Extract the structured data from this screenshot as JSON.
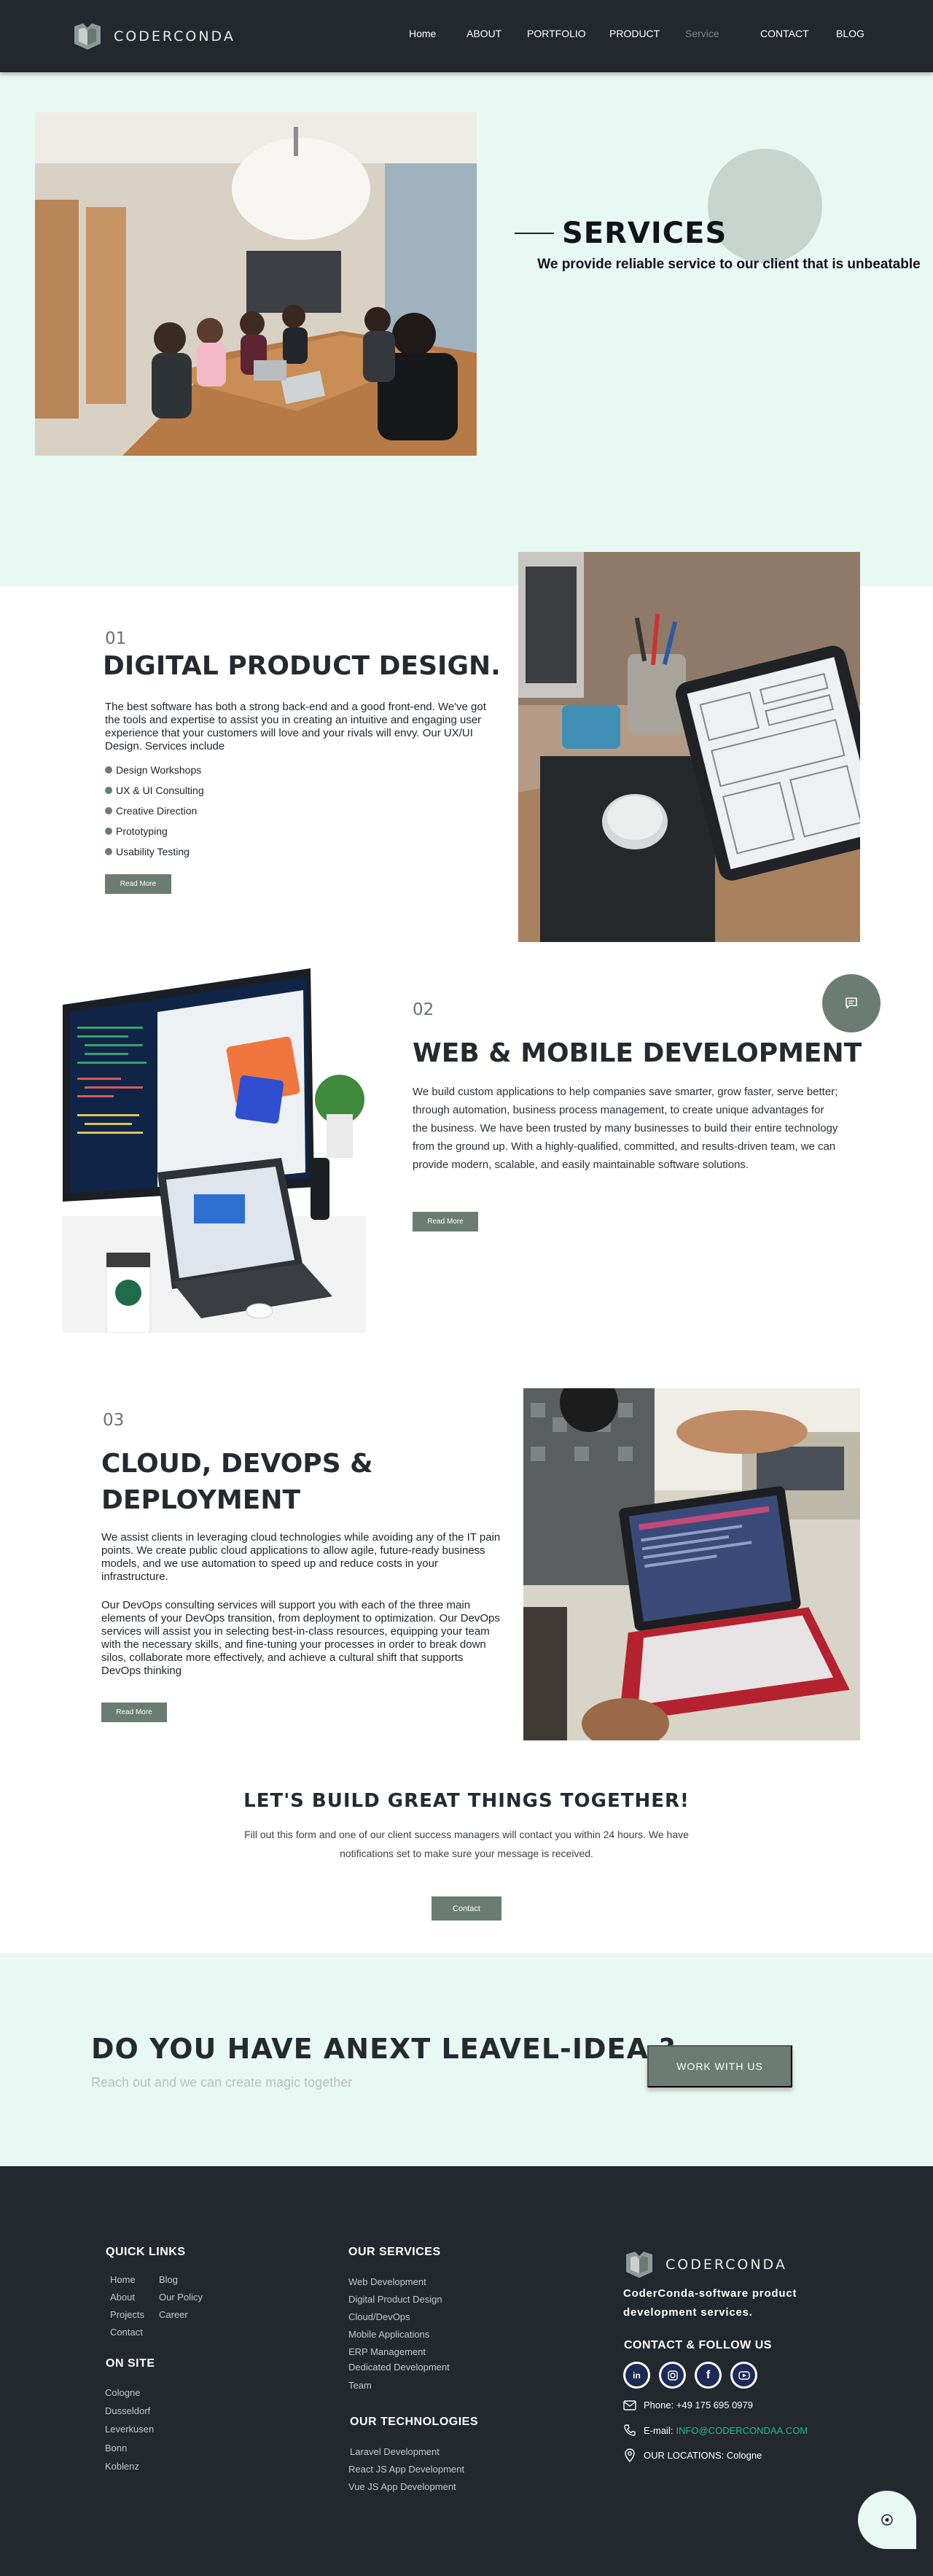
{
  "brand": {
    "name": "CODERCONDA"
  },
  "nav": [
    {
      "label": "Home"
    },
    {
      "label": "ABOUT"
    },
    {
      "label": "PORTFOLIO"
    },
    {
      "label": "PRODUCT"
    },
    {
      "label": "Service"
    },
    {
      "label": "CONTACT"
    },
    {
      "label": "BLOG"
    }
  ],
  "hero": {
    "title": "SERVICES",
    "subtitle": "We provide reliable service to our client that is unbeatable"
  },
  "services": [
    {
      "number": "01",
      "title": "DIGITAL PRODUCT DESIGN.",
      "text": "The best software has both a strong back-end and a good front-end. We've got the tools and expertise to assist you in creating an intuitive and engaging user experience that your customers will love and your rivals will envy. Our UX/UI Design. Services include",
      "bullets": [
        "Design Workshops",
        "UX & UI Consulting",
        "Creative Direction",
        "Prototyping",
        "Usability Testing"
      ],
      "button": "Read More"
    },
    {
      "number": "02",
      "title": "WEB & MOBILE DEVELOPMENT",
      "text": "We build custom applications to help companies save smarter, grow faster, serve better; through automation, business process management, to create unique advantages for the business. We have been trusted by many businesses to build their entire technology from the ground up. With a highly-qualified, committed, and results-driven team, we can provide modern, scalable, and easily maintainable software solutions.",
      "button": "Read More"
    },
    {
      "number": "03",
      "title_line1": "CLOUD, DEVOPS &",
      "title_line2": "DEPLOYMENT",
      "text": "We assist clients in leveraging cloud technologies while avoiding any of the IT pain points. We create public cloud applications to allow agile, future-ready business models, and we use automation to speed up and reduce costs in your infrastructure.",
      "text2": "Our DevOps consulting services will support you with each of the three main elements of your DevOps transition, from deployment to optimization. Our DevOps services will assist you in selecting best-in-class resources, equipping your team with the necessary skills, and fine-tuning your processes in order to break down silos, collaborate more effectively, and achieve a cultural shift that supports DevOps thinking",
      "button": "Read More"
    }
  ],
  "cta": {
    "title": "LET'S BUILD GREAT THINGS TOGETHER!",
    "text": "Fill out this form and one of our client success managers will contact you within 24 hours. We have notifications set to make sure your message is received.",
    "button": "Contact"
  },
  "idea": {
    "title": "DO YOU HAVE ANEXT LEAVEL-IDEA ?",
    "subtitle": "Reach out and we can create magic together",
    "button": "WORK WITH US"
  },
  "footer": {
    "quick_links_title": "QUICK LINKS",
    "quick_links_col1": [
      "Home",
      "About",
      "Projects",
      "Contact"
    ],
    "quick_links_col2": [
      "Blog",
      "Our Policy",
      "Career"
    ],
    "on_site_title": "ON SITE",
    "on_site": [
      "Cologne",
      "Dusseldorf",
      "Leverkusen",
      "Bonn",
      "Koblenz"
    ],
    "services_title": "OUR SERVICES",
    "services": [
      "Web Development",
      "Digital Product Design",
      "Cloud/DevOps",
      "Mobile Applications",
      "ERP Management",
      "Dedicated Development",
      "Team"
    ],
    "tech_title": "OUR TECHNOLOGIES",
    "tech": [
      "Laravel Development",
      "React JS App Development",
      "Vue JS App Development"
    ],
    "brand": "CODERCONDA",
    "tagline": "CoderConda-software product development services.",
    "follow_title": "CONTACT & FOLLOW US",
    "social": [
      "linkedin-icon",
      "instagram-icon",
      "facebook-icon",
      "youtube-icon"
    ],
    "phone": "Phone: +49 175 695 0979",
    "email_label": "E-mail:",
    "email": "INFO@CODERCONDAA.COM",
    "location": "OUR LOCATIONS: Cologne"
  },
  "colors": {
    "nav_bg": "#23272e",
    "mint_bg": "#e8f8f3",
    "accent_green": "#6b7d72",
    "email_green": "#1fbf8a"
  }
}
